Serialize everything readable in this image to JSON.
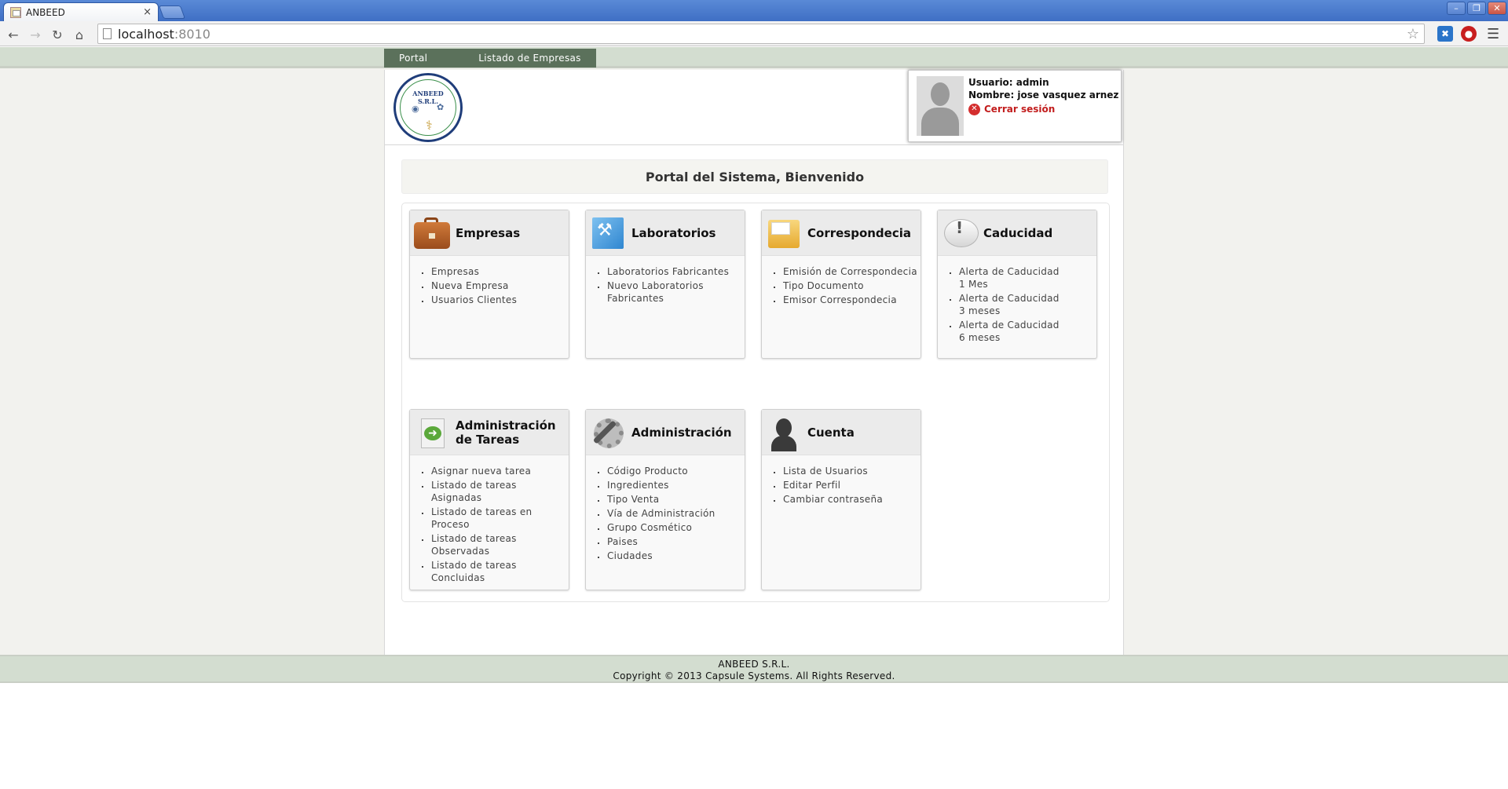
{
  "browser": {
    "tab_title": "ANBEED",
    "tab_close": "×",
    "url_host": "localhost",
    "url_port": ":8010",
    "window_controls": [
      "–",
      "❐",
      "✕"
    ]
  },
  "nav": {
    "portal": "Portal",
    "listado_empresas": "Listado de Empresas"
  },
  "logo": {
    "seal_text": "ANBEED S.R.L."
  },
  "user": {
    "usuario": "Usuario: admin",
    "nombre": "Nombre: jose vasquez arnez",
    "logout": "Cerrar sesión"
  },
  "welcome": "Portal del Sistema, Bienvenido",
  "modules": [
    {
      "title": "Empresas",
      "icon": "briefcase-icon",
      "links": [
        "Empresas",
        "Nueva Empresa",
        "Usuarios Clientes"
      ]
    },
    {
      "title": "Laboratorios",
      "icon": "hammer-icon",
      "links": [
        "Laboratorios Fabricantes",
        "Nuevo Laboratorios Fabricantes"
      ]
    },
    {
      "title": "Correspondecia",
      "icon": "mail-icon",
      "links": [
        "Emisión de Correspondecia",
        "Tipo Documento",
        "Emisor Correspondecia"
      ]
    },
    {
      "title": "Caducidad",
      "icon": "alert-bubble-icon",
      "links": [
        "Alerta de Caducidad 1 Mes",
        "Alerta de Caducidad 3 meses",
        "Alerta de Caducidad 6 meses"
      ]
    },
    {
      "title": "Administración de Tareas",
      "icon": "task-document-icon",
      "links": [
        "Asignar nueva tarea",
        "Listado de tareas Asignadas",
        "Listado de tareas en Proceso",
        "Listado de tareas Observadas",
        "Listado de tareas Concluidas"
      ]
    },
    {
      "title": "Administración",
      "icon": "gear-wrench-icon",
      "links": [
        "Código Producto",
        "Ingredientes",
        "Tipo Venta",
        "Vía de Administración",
        "Grupo Cosmético",
        "Paises",
        "Ciudades"
      ]
    },
    {
      "title": "Cuenta",
      "icon": "user-account-icon",
      "links": [
        "Lista de Usuarios",
        "Editar Perfil",
        "Cambiar contraseña"
      ]
    }
  ],
  "footer": {
    "company": "ANBEED S.R.L.",
    "copyright": "Copyright © 2013 Capsule Systems. All Rights Reserved."
  },
  "colors": {
    "nav_bg": "#5b715b",
    "strip_bg": "#d3ddd0",
    "logout": "#c21d1d"
  }
}
